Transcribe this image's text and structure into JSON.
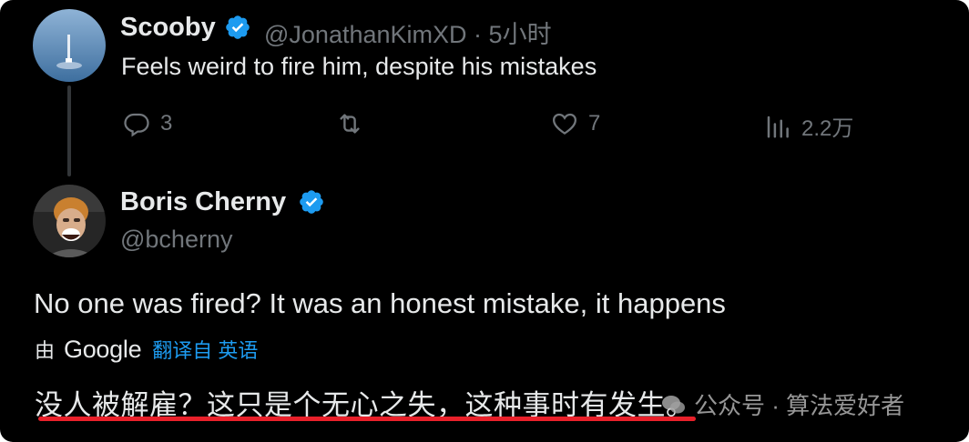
{
  "tweet1": {
    "name": "Scooby",
    "handle": "@JonathanKimXD",
    "separator": "·",
    "time": "5小时",
    "text": "Feels weird to fire him, despite his mistakes",
    "replies": "3",
    "likes": "7",
    "views": "2.2万"
  },
  "tweet2": {
    "name": "Boris Cherny",
    "handle": "@bcherny",
    "text": "No one was fired? It was an honest mistake, it happens",
    "translate_by": "由",
    "translate_provider": "Google",
    "translate_link": "翻译自 英语",
    "translated_text": "没人被解雇？这只是个无心之失，这种事时有发生。"
  },
  "watermark": {
    "text": "公众号 · 算法爱好者"
  },
  "colors": {
    "background": "#000000",
    "text": "#e7e9ea",
    "muted": "#71767b",
    "link": "#1d9bf0",
    "verified": "#1d9bf0",
    "underline": "#e8202a"
  },
  "icons": {
    "reply": "reply-icon",
    "retweet": "retweet-icon",
    "like": "heart-icon",
    "views": "views-chart-icon",
    "verified": "verified-badge-icon"
  }
}
